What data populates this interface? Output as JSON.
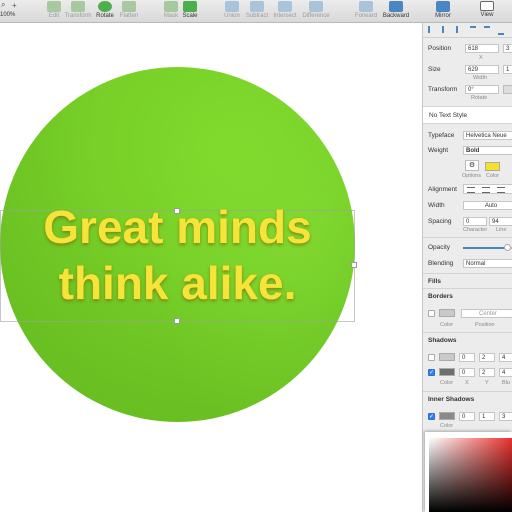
{
  "toolbar": {
    "zoom": "100%",
    "plus": "+",
    "items": [
      {
        "label": "Edit",
        "active": false
      },
      {
        "label": "Transform",
        "active": false
      },
      {
        "label": "Rotate",
        "active": true
      },
      {
        "label": "Flatten",
        "active": false
      },
      {
        "label": "Mask",
        "active": false
      },
      {
        "label": "Scale",
        "active": true
      },
      {
        "label": "Union",
        "active": false
      },
      {
        "label": "Subtract",
        "active": false
      },
      {
        "label": "Intersect",
        "active": false
      },
      {
        "label": "Difference",
        "active": false
      },
      {
        "label": "Forward",
        "active": false
      },
      {
        "label": "Backward",
        "active": true
      },
      {
        "label": "Mirror",
        "active": true
      },
      {
        "label": "View",
        "active": true
      }
    ]
  },
  "canvas": {
    "text_line1": "Great minds",
    "text_line2": "think alike.",
    "circle_color": "#74cc27",
    "text_color": "#f5e53a"
  },
  "inspector": {
    "position": {
      "label": "Position",
      "x": "618",
      "y": "3",
      "x_caption": "X"
    },
    "size": {
      "label": "Size",
      "w": "629",
      "h": "1",
      "w_caption": "Width"
    },
    "transform": {
      "label": "Transform",
      "rotate": "0°",
      "rotate_caption": "Rotate"
    },
    "text_style": "No Text Style",
    "typeface": {
      "label": "Typeface",
      "value": "Helvetica Neue"
    },
    "weight": {
      "label": "Weight",
      "value": "Bold"
    },
    "options": {
      "options_caption": "Options",
      "color_caption": "Color",
      "color": "#f5e02a"
    },
    "alignment": {
      "label": "Alignment"
    },
    "width": {
      "label": "Width",
      "value": "Auto"
    },
    "spacing": {
      "label": "Spacing",
      "character": "0",
      "line": "94",
      "character_caption": "Character",
      "line_caption": "Line"
    },
    "opacity": {
      "label": "Opacity",
      "fraction": 0.88
    },
    "blending": {
      "label": "Blending",
      "value": "Normal"
    },
    "fills": {
      "title": "Fills"
    },
    "borders": {
      "title": "Borders",
      "position": "Center",
      "color_caption": "Color",
      "position_caption": "Position"
    },
    "shadows": {
      "title": "Shadows",
      "rows": [
        {
          "checked": false,
          "x": "0",
          "y": "2",
          "blur": "4"
        },
        {
          "checked": true,
          "x": "0",
          "y": "2",
          "blur": "4"
        }
      ],
      "color_caption": "Color",
      "x_caption": "X",
      "y_caption": "Y",
      "blur_caption": "Blu"
    },
    "inner_shadows": {
      "title": "Inner Shadows",
      "row": {
        "checked": true,
        "x": "0",
        "y": "1",
        "blur": "3"
      },
      "color_caption": "Color"
    }
  }
}
